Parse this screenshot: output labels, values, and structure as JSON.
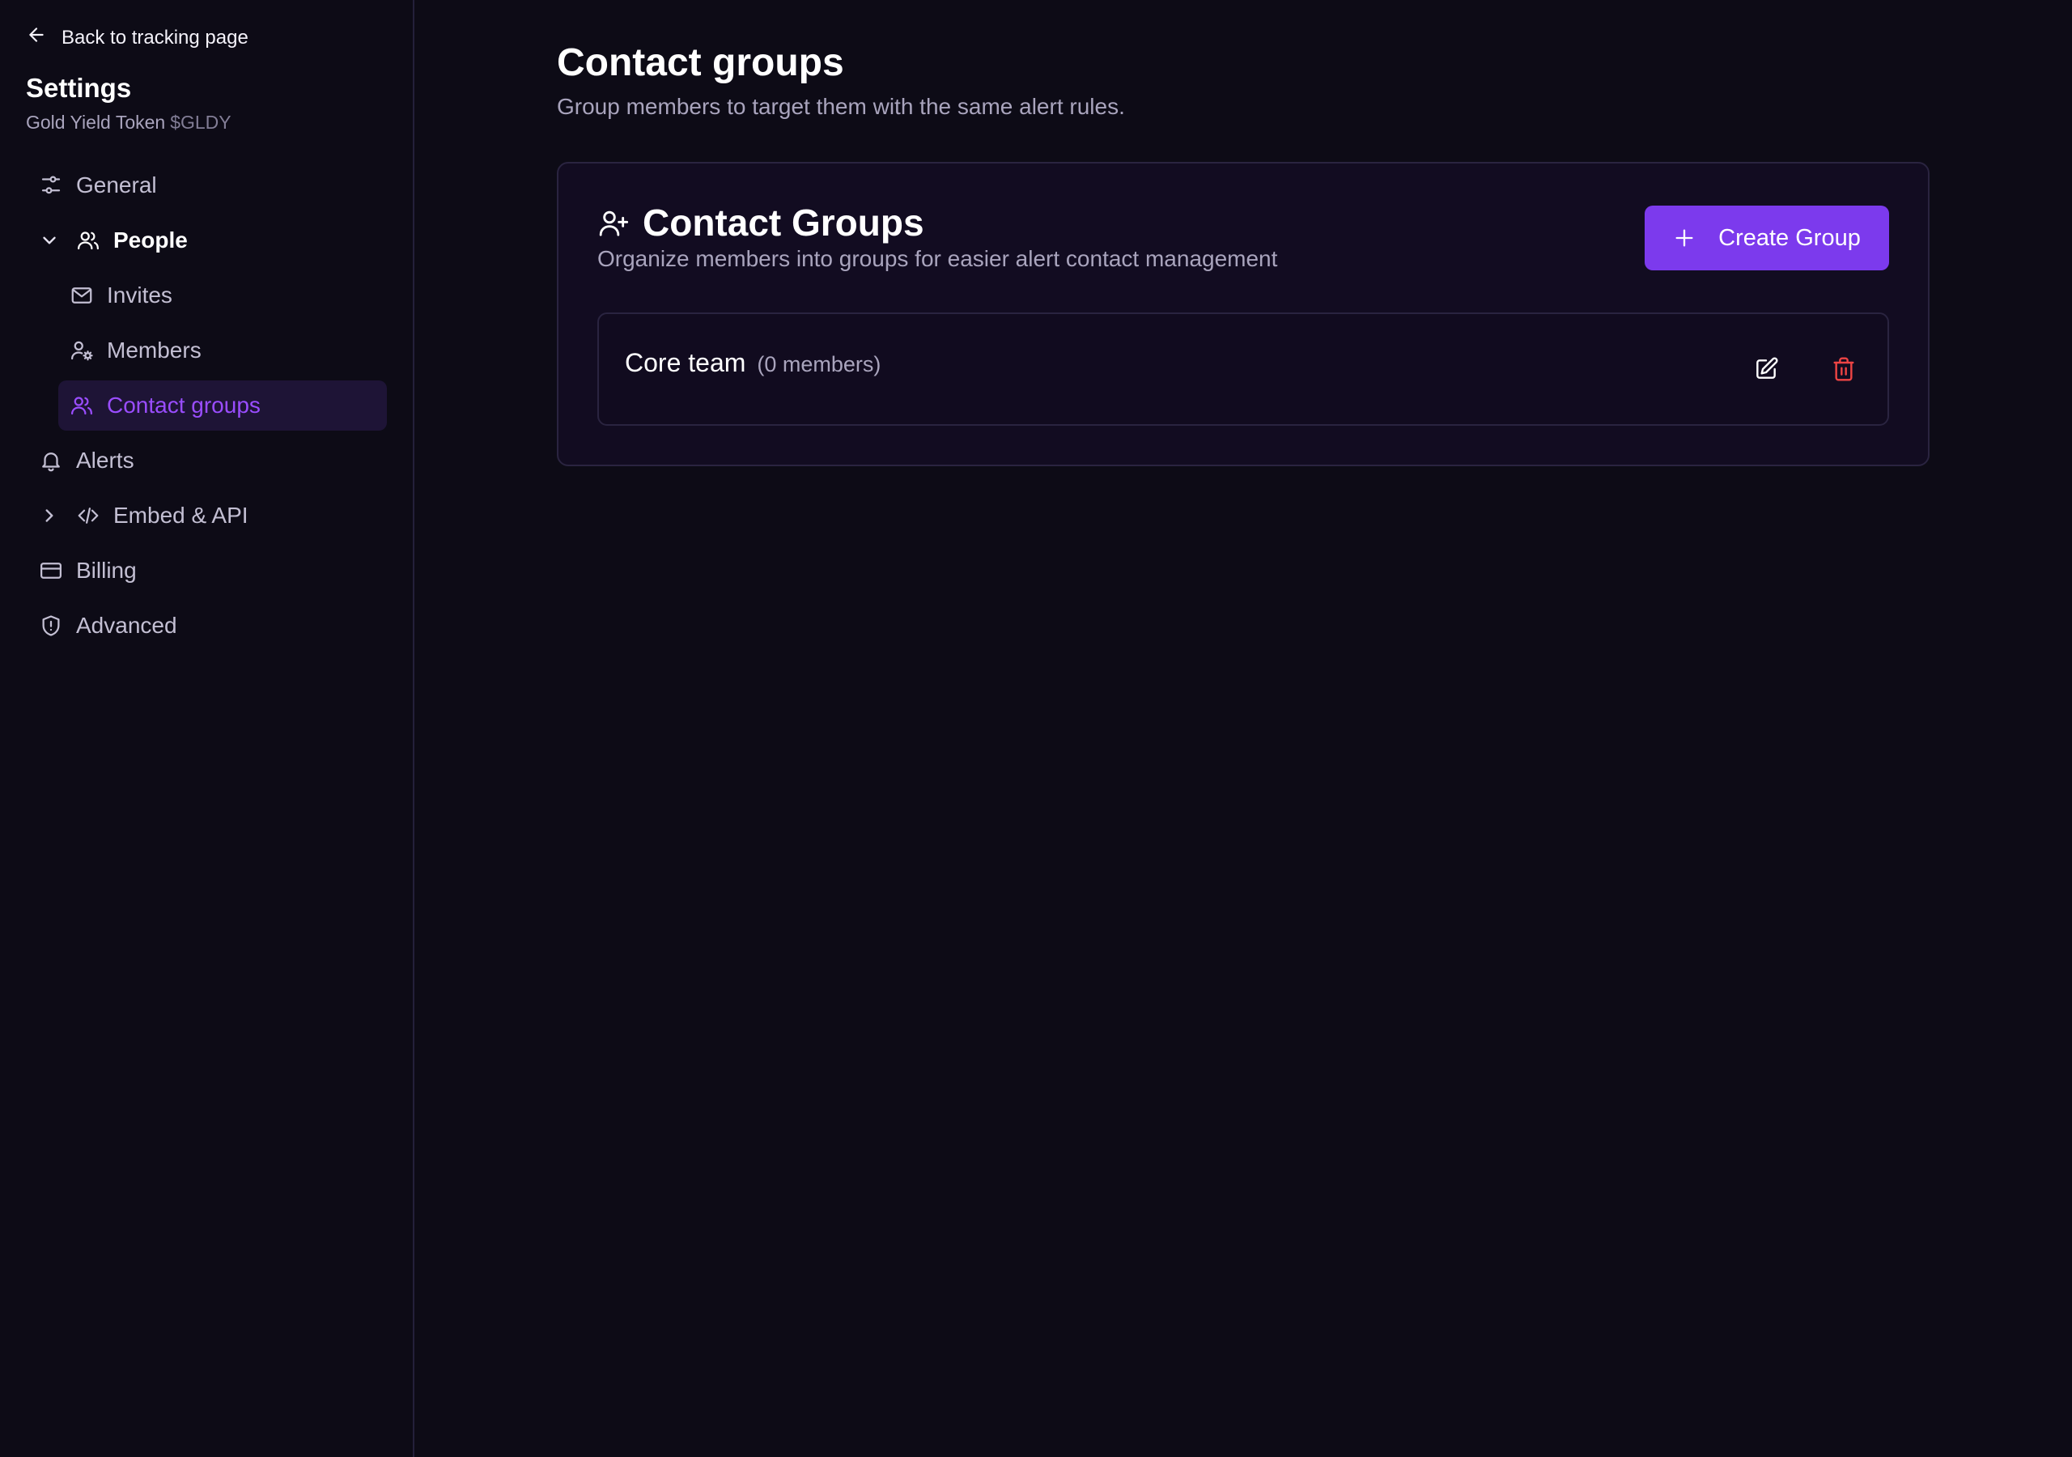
{
  "sidebar": {
    "back_label": "Back to tracking page",
    "title": "Settings",
    "project_name": "Gold Yield Token",
    "project_ticker": "$GLDY",
    "items": [
      {
        "label": "General",
        "icon": "sliders-icon"
      },
      {
        "label": "People",
        "icon": "users-icon",
        "expanded": true
      },
      {
        "label": "Invites",
        "icon": "mail-icon"
      },
      {
        "label": "Members",
        "icon": "user-cog-icon"
      },
      {
        "label": "Contact groups",
        "icon": "users-icon",
        "active": true
      },
      {
        "label": "Alerts",
        "icon": "bell-icon"
      },
      {
        "label": "Embed & API",
        "icon": "code-icon",
        "expanded": false
      },
      {
        "label": "Billing",
        "icon": "credit-card-icon"
      },
      {
        "label": "Advanced",
        "icon": "shield-alert-icon"
      }
    ]
  },
  "main": {
    "title": "Contact groups",
    "subtitle": "Group members to target them with the same alert rules."
  },
  "card": {
    "title": "Contact Groups",
    "description": "Organize members into groups for easier alert contact management",
    "create_label": "Create Group",
    "groups": [
      {
        "name": "Core team",
        "count": "(0 members)"
      }
    ]
  },
  "colors": {
    "background": "#0d0b16",
    "card_background": "#120c21",
    "accent": "#7c3aed",
    "active_text": "#9a4dff",
    "danger": "#ef4444"
  }
}
